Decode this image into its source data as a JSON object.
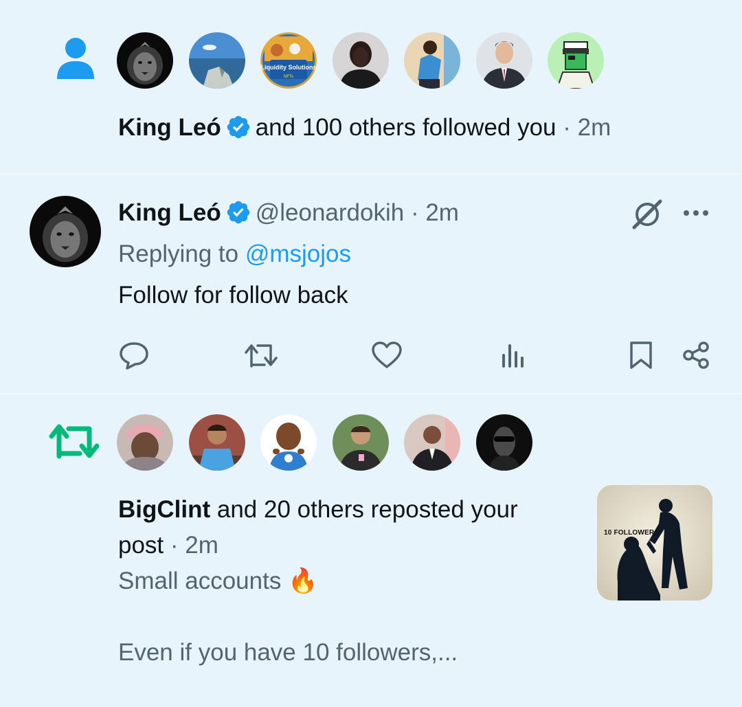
{
  "follow_notification": {
    "icon": "person-icon",
    "accent": "#1d9bf0",
    "avatars": [
      "lion-avatar",
      "cliff-avatar",
      "liquidity-solutions-avatar",
      "woman-avatar",
      "man-blue-avatar",
      "man-suit-avatar",
      "pixel-punk-avatar"
    ],
    "avatar_badge_text": "Liquidity Solutions",
    "avatar_badge_sub": "NFTs",
    "name": "King Leó",
    "verified": true,
    "text": "and 100 others followed you",
    "separator": "·",
    "time": "2m"
  },
  "reply_post": {
    "author_name": "King Leó",
    "verified": true,
    "handle": "@leonardokih",
    "separator": "·",
    "time": "2m",
    "replying_to_label": "Replying to",
    "replying_to_handle": "@msjojos",
    "body": "Follow for follow back",
    "header_icons": [
      "grok-icon",
      "more-options-icon"
    ],
    "actions": [
      "reply-icon",
      "repost-icon",
      "like-icon",
      "views-icon",
      "bookmark-icon",
      "share-icon"
    ]
  },
  "repost_notification": {
    "icon": "repost-icon",
    "accent": "#00ba7c",
    "avatars": [
      "pink-cap-avatar",
      "boy-avatar",
      "cartoon-avatar",
      "messi-avatar",
      "man-mirror-avatar",
      "sunglasses-avatar"
    ],
    "name": "BigClint",
    "text_line1": "and 20 others reposted your",
    "text_line2": "post",
    "separator": "·",
    "time": "2m",
    "preview_line1": "Small accounts",
    "preview_emoji": "🔥",
    "preview_line2": "Even if you have 10 followers,...",
    "thumbnail_caption": "10 FOLLOWERS"
  }
}
